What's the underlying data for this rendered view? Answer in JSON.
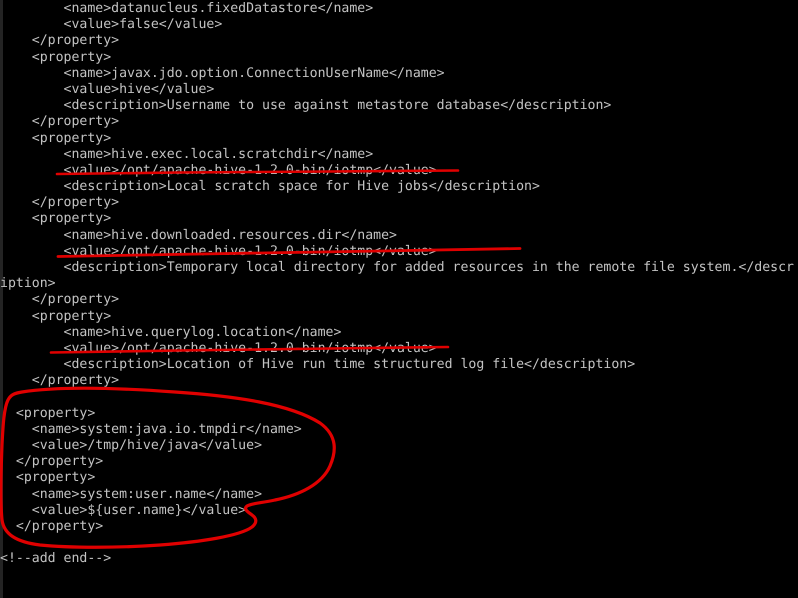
{
  "window": {
    "kind": "terminal-console",
    "background_color": "#000000",
    "text_color": "#c3c3c3",
    "annotation_color": "#e00000",
    "font_size_px": 13,
    "line_height_px": 16
  },
  "console": {
    "lines": [
      "        <name>datanucleus.fixedDatastore</name>",
      "        <value>false</value>",
      "    </property>",
      "    <property>",
      "        <name>javax.jdo.option.ConnectionUserName</name>",
      "        <value>hive</value>",
      "        <description>Username to use against metastore database</description>",
      "    </property>",
      "    <property>",
      "        <name>hive.exec.local.scratchdir</name>",
      "        <value>/opt/apache-hive-1.2.0-bin/iotmp</value>",
      "        <description>Local scratch space for Hive jobs</description>",
      "    </property>",
      "    <property>",
      "        <name>hive.downloaded.resources.dir</name>",
      "        <value>/opt/apache-hive-1.2.0-bin/iotmp</value>",
      "        <description>Temporary local directory for added resources in the remote file system.</descr",
      "iption>",
      "    </property>",
      "    <property>",
      "        <name>hive.querylog.location</name>",
      "        <value>/opt/apache-hive-1.2.0-bin/iotmp</value>",
      "        <description>Location of Hive run time structured log file</description>",
      "    </property>",
      "",
      "  <property>",
      "    <name>system:java.io.tmpdir</name>",
      "    <value>/tmp/hive/java</value>",
      "  </property>",
      "  <property>",
      "    <name>system:user.name</name>",
      "    <value>${user.name}</value>",
      "  </property>",
      "",
      "<!--add end-->"
    ]
  },
  "annotations": {
    "color": "#e00000",
    "underlines": [
      {
        "name": "underline-hive-exec-local-scratchdir-value",
        "target_text": "<value>/opt/apache-hive-1.2.0-bin/iotmp</value>"
      },
      {
        "name": "underline-hive-downloaded-resources-dir-value",
        "target_text": "<value>/opt/apache-hive-1.2.0-bin/iotmp</value>"
      },
      {
        "name": "underline-hive-querylog-location-value",
        "target_text": "<value>/opt/apache-hive-1.2.0-bin/iotmp</value>"
      }
    ],
    "circle": {
      "name": "circle-system-properties-block",
      "encloses": [
        "<property>",
        "<name>system:java.io.tmpdir</name>",
        "<value>/tmp/hive/java</value>",
        "</property>",
        "<property>",
        "<name>system:user.name</name>",
        "<value>${user.name}</value>",
        "</property>"
      ]
    }
  }
}
